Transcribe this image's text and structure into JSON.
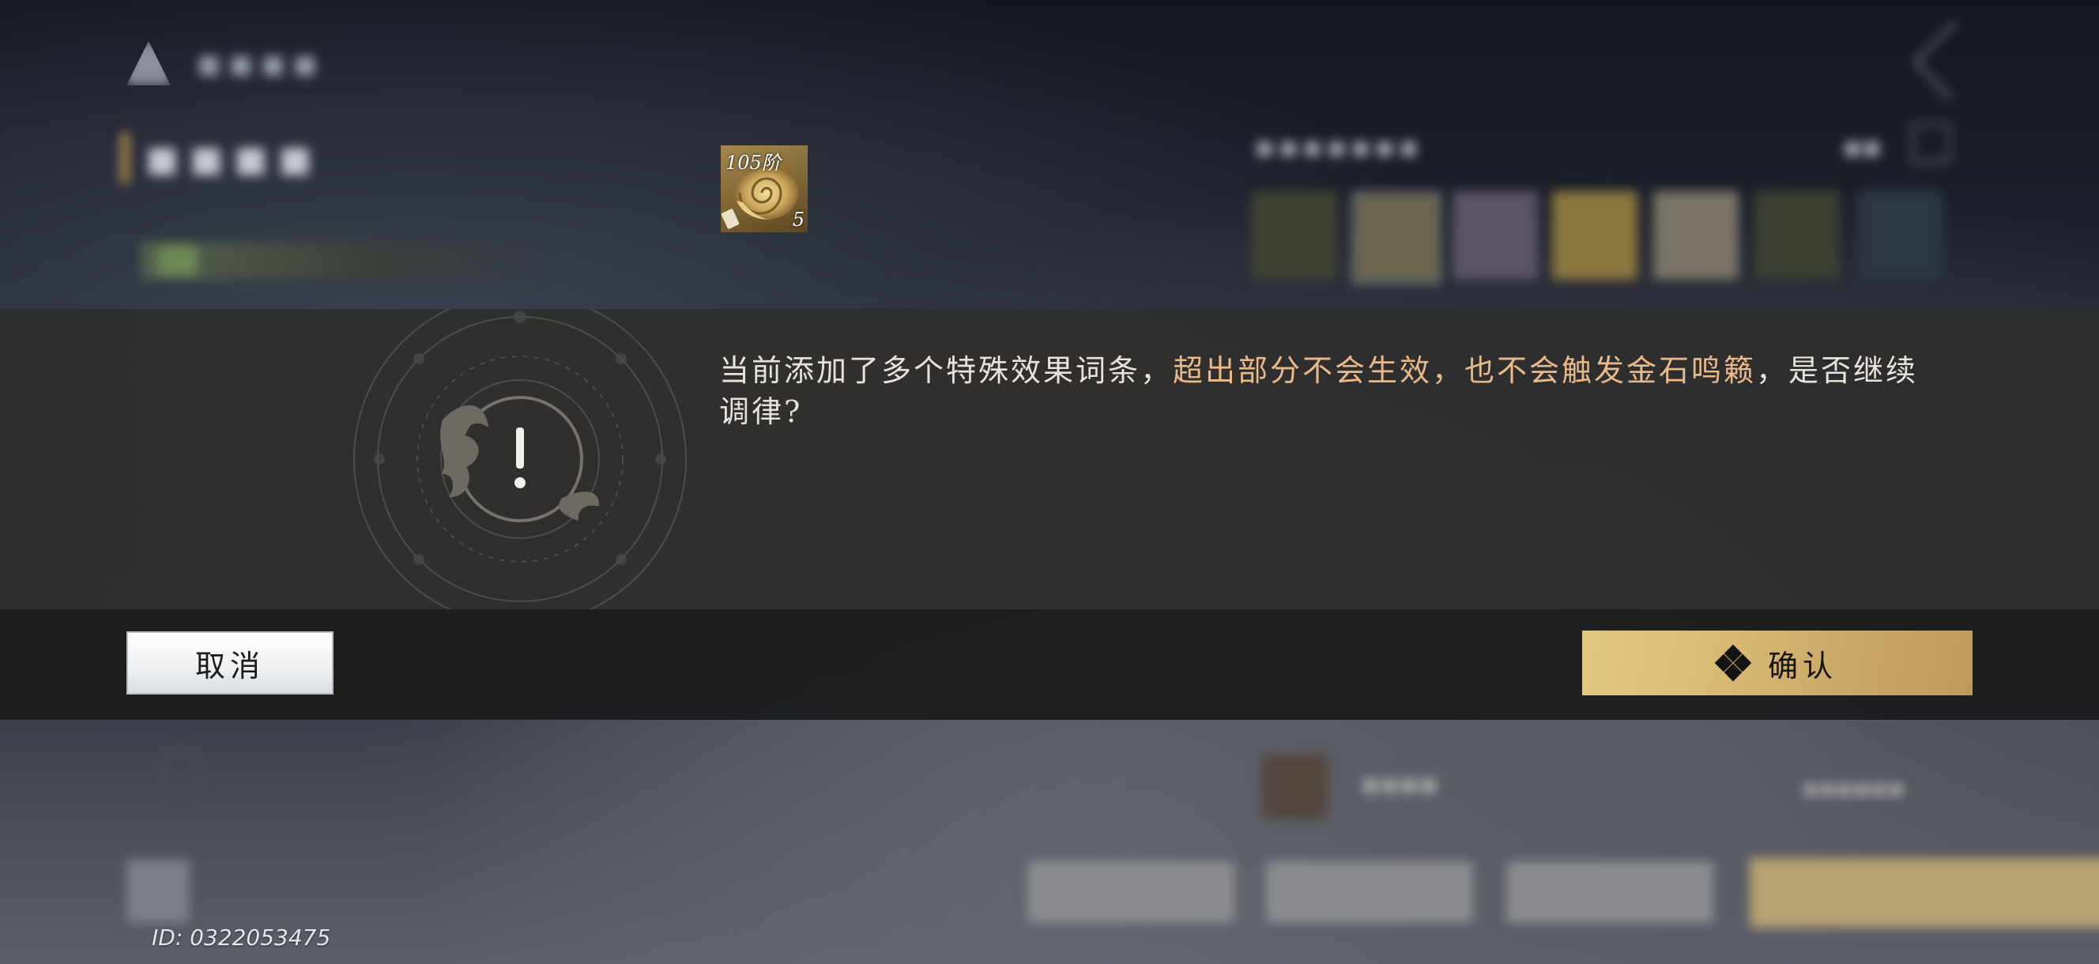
{
  "background": {
    "note_blurred": true
  },
  "dialog": {
    "message_part1": "当前添加了多个特殊效果词条，",
    "message_highlight": "超出部分不会生效，也不会触发金石鸣籁",
    "message_part2": "，是否继续调律?",
    "icon": "warning-emblem-icon",
    "highlight_color": "#eab98a",
    "item": {
      "tier_label": "105阶",
      "count": "5",
      "icon": "golden-conch-icon"
    },
    "cancel_label": "取消",
    "confirm_label": "确认",
    "confirm_icon": "four-diamond-icon",
    "confirm_color": "#d8bb73"
  },
  "footer": {
    "player_id": "ID: 0322053475"
  }
}
